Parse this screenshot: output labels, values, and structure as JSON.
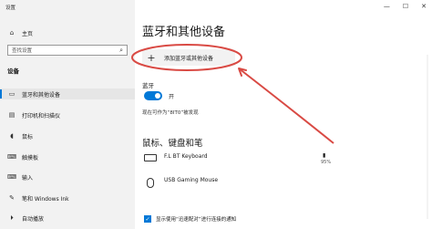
{
  "window": {
    "title": "设置",
    "minimize": "—",
    "maximize": "☐",
    "close": "✕"
  },
  "sidebar": {
    "home": {
      "icon": "⌂",
      "label": "主页"
    },
    "search": {
      "placeholder": "查找设置",
      "icon": "⌕"
    },
    "section": "设备",
    "items": [
      {
        "icon": "▭",
        "label": "蓝牙和其他设备"
      },
      {
        "icon": "▤",
        "label": "打印机和扫描仪"
      },
      {
        "icon": "◖",
        "label": "鼠标"
      },
      {
        "icon": "⌨",
        "label": "触摸板"
      },
      {
        "icon": "⌨",
        "label": "输入"
      },
      {
        "icon": "✎",
        "label": "笔和 Windows Ink"
      },
      {
        "icon": "⏵",
        "label": "自动播放"
      }
    ]
  },
  "main": {
    "title": "蓝牙和其他设备",
    "add_button": {
      "icon": "+",
      "label": "添加蓝牙或其他设备"
    },
    "bluetooth": {
      "label": "蓝牙",
      "toggle_on": true,
      "toggle_text": "开",
      "discover": "现在可作为“8IT0”被发现"
    },
    "devices_heading": "鼠标、键盘和笔",
    "devices": [
      {
        "name": "F.L BT Keyboard",
        "battery_icon": "▮",
        "battery": "95%",
        "kind": "keyboard"
      },
      {
        "name": "USB Gaming Mouse",
        "kind": "mouse"
      }
    ],
    "metered": {
      "checked": true,
      "label": "显示使用“迅速配对”进行连接的通知"
    }
  },
  "colors": {
    "accent": "#0078d7",
    "annotation": "#d94a44"
  }
}
